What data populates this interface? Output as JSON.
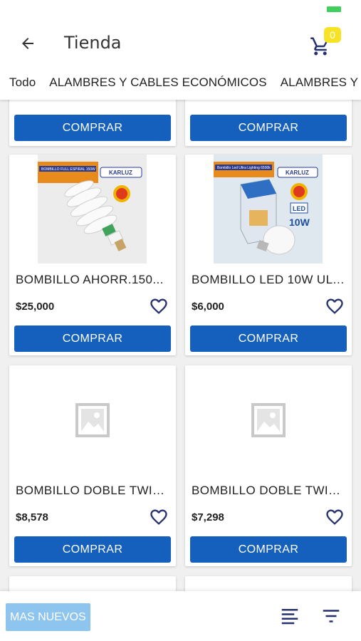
{
  "status_bar": {
    "battery_color": "#3ecf5c"
  },
  "app_bar": {
    "back_icon": "arrow-left-icon",
    "title": "Tienda",
    "cart_icon": "cart-icon",
    "cart_count": "0"
  },
  "tabs": [
    {
      "label": "Todo"
    },
    {
      "label": "ALAMBRES Y CABLES ECONÓMICOS"
    },
    {
      "label": "ALAMBRES Y CABLES"
    }
  ],
  "buy_label": "COMPRAR",
  "products": [
    {
      "name": "BOMBILLO AHORR.150...",
      "price": "$25,000",
      "image": "spiral-bulb-150w-karluz"
    },
    {
      "name": "BOMBILLO LED 10W UL ...",
      "price": "$6,000",
      "image": "led-bulb-10w-karluz"
    },
    {
      "name": "BOMBILLO DOBLE TWIN...",
      "price": "$8,578",
      "image": "placeholder-image"
    },
    {
      "name": "BOMBILLO DOBLE TWIN...",
      "price": "$7,298",
      "image": "placeholder-image"
    }
  ],
  "product_images": {
    "p1_brand": "KARLUZ",
    "p1_banner": "BOMBILLO FULL ESPIRAL 150W",
    "p2_brand": "KARLUZ",
    "p2_banner": "Bombillo Led Ultra Lighting 6500k",
    "p2_wattage": "10W",
    "p2_led": "LED"
  },
  "bottom_bar": {
    "sort_label": "MAS NUEVOS",
    "list_icon": "text-align-icon",
    "filter_icon": "filter-icon"
  },
  "colors": {
    "primary": "#1560bd",
    "sort_button": "#8ec5ee",
    "badge": "#f7e225",
    "heart": "#27306e"
  }
}
